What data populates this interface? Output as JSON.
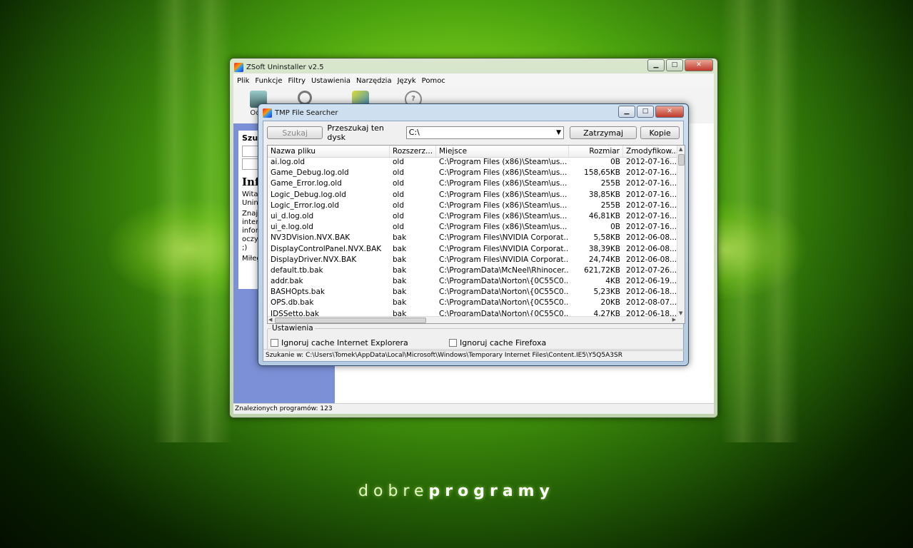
{
  "brand": {
    "light": "dobre",
    "bold": "programy"
  },
  "main_window": {
    "title": "ZSoft Uninstaller v2.5",
    "menu": [
      "Plik",
      "Funkcje",
      "Filtry",
      "Ustawienia",
      "Narzędzia",
      "Język",
      "Pomoc"
    ],
    "toolbar_first_label": "Odin",
    "side": {
      "search_heading": "Szuk",
      "info_heading": "Info",
      "p1a": "Wita",
      "p1b": "Unin",
      "p2a": "Znaj",
      "p2b": "inter",
      "p2c": "infor",
      "p2d": "oczy",
      "p2e": ";)",
      "p3": "Miłeg"
    },
    "status": "Znalezionych programów: 123"
  },
  "dialog": {
    "title": "TMP File Searcher",
    "search_button": "Szukaj",
    "drive_label": "Przeszukaj ten dysk",
    "drive_value": "C:\\",
    "stop_button": "Zatrzymaj",
    "copy_button": "Kopie",
    "columns": [
      "Nazwa pliku",
      "Rozszerz...",
      "Miejsce",
      "Rozmiar",
      "Zmodyfikow..."
    ],
    "rows": [
      [
        "ai.log.old",
        "old",
        "C:\\Program Files (x86)\\Steam\\us...",
        "0B",
        "2012-07-16..."
      ],
      [
        "Game_Debug.log.old",
        "old",
        "C:\\Program Files (x86)\\Steam\\us...",
        "158,65KB",
        "2012-07-16..."
      ],
      [
        "Game_Error.log.old",
        "old",
        "C:\\Program Files (x86)\\Steam\\us...",
        "255B",
        "2012-07-16..."
      ],
      [
        "Logic_Debug.log.old",
        "old",
        "C:\\Program Files (x86)\\Steam\\us...",
        "38,85KB",
        "2012-07-16..."
      ],
      [
        "Logic_Error.log.old",
        "old",
        "C:\\Program Files (x86)\\Steam\\us...",
        "255B",
        "2012-07-16..."
      ],
      [
        "ui_d.log.old",
        "old",
        "C:\\Program Files (x86)\\Steam\\us...",
        "46,81KB",
        "2012-07-16..."
      ],
      [
        "ui_e.log.old",
        "old",
        "C:\\Program Files (x86)\\Steam\\us...",
        "0B",
        "2012-07-16..."
      ],
      [
        "NV3DVision.NVX.BAK",
        "bak",
        "C:\\Program Files\\NVIDIA Corporat...",
        "5,58KB",
        "2012-06-08..."
      ],
      [
        "DisplayControlPanel.NVX.BAK",
        "bak",
        "C:\\Program Files\\NVIDIA Corporat...",
        "38,39KB",
        "2012-06-08..."
      ],
      [
        "DisplayDriver.NVX.BAK",
        "bak",
        "C:\\Program Files\\NVIDIA Corporat...",
        "24,74KB",
        "2012-06-08..."
      ],
      [
        "default.tb.bak",
        "bak",
        "C:\\ProgramData\\McNeel\\Rhinocer...",
        "621,72KB",
        "2012-07-26..."
      ],
      [
        "addr.bak",
        "bak",
        "C:\\ProgramData\\Norton\\{0C55C0...",
        "4KB",
        "2012-06-19..."
      ],
      [
        "BASHOpts.bak",
        "bak",
        "C:\\ProgramData\\Norton\\{0C55C0...",
        "5,23KB",
        "2012-06-18..."
      ],
      [
        "OPS.db.bak",
        "bak",
        "C:\\ProgramData\\Norton\\{0C55C0...",
        "20KB",
        "2012-08-07..."
      ],
      [
        "IDSSetto.bak",
        "bak",
        "C:\\ProgramData\\Norton\\{0C55C0...",
        "4,27KB",
        "2012-06-18..."
      ]
    ],
    "settings_label": "Ustawienia",
    "ignore_ie": "Ignoruj cache Internet Explorera",
    "ignore_ff": "Ignoruj cache Firefoxa",
    "status": "Szukanie w: C:\\Users\\Tomek\\AppData\\Local\\Microsoft\\Windows\\Temporary Internet Files\\Content.IE5\\Y5Q5A3SR"
  },
  "colors": {
    "wallpaper_accent": "#7fd21c",
    "side_panel": "#7b90d6",
    "close_button": "#c0392b"
  }
}
